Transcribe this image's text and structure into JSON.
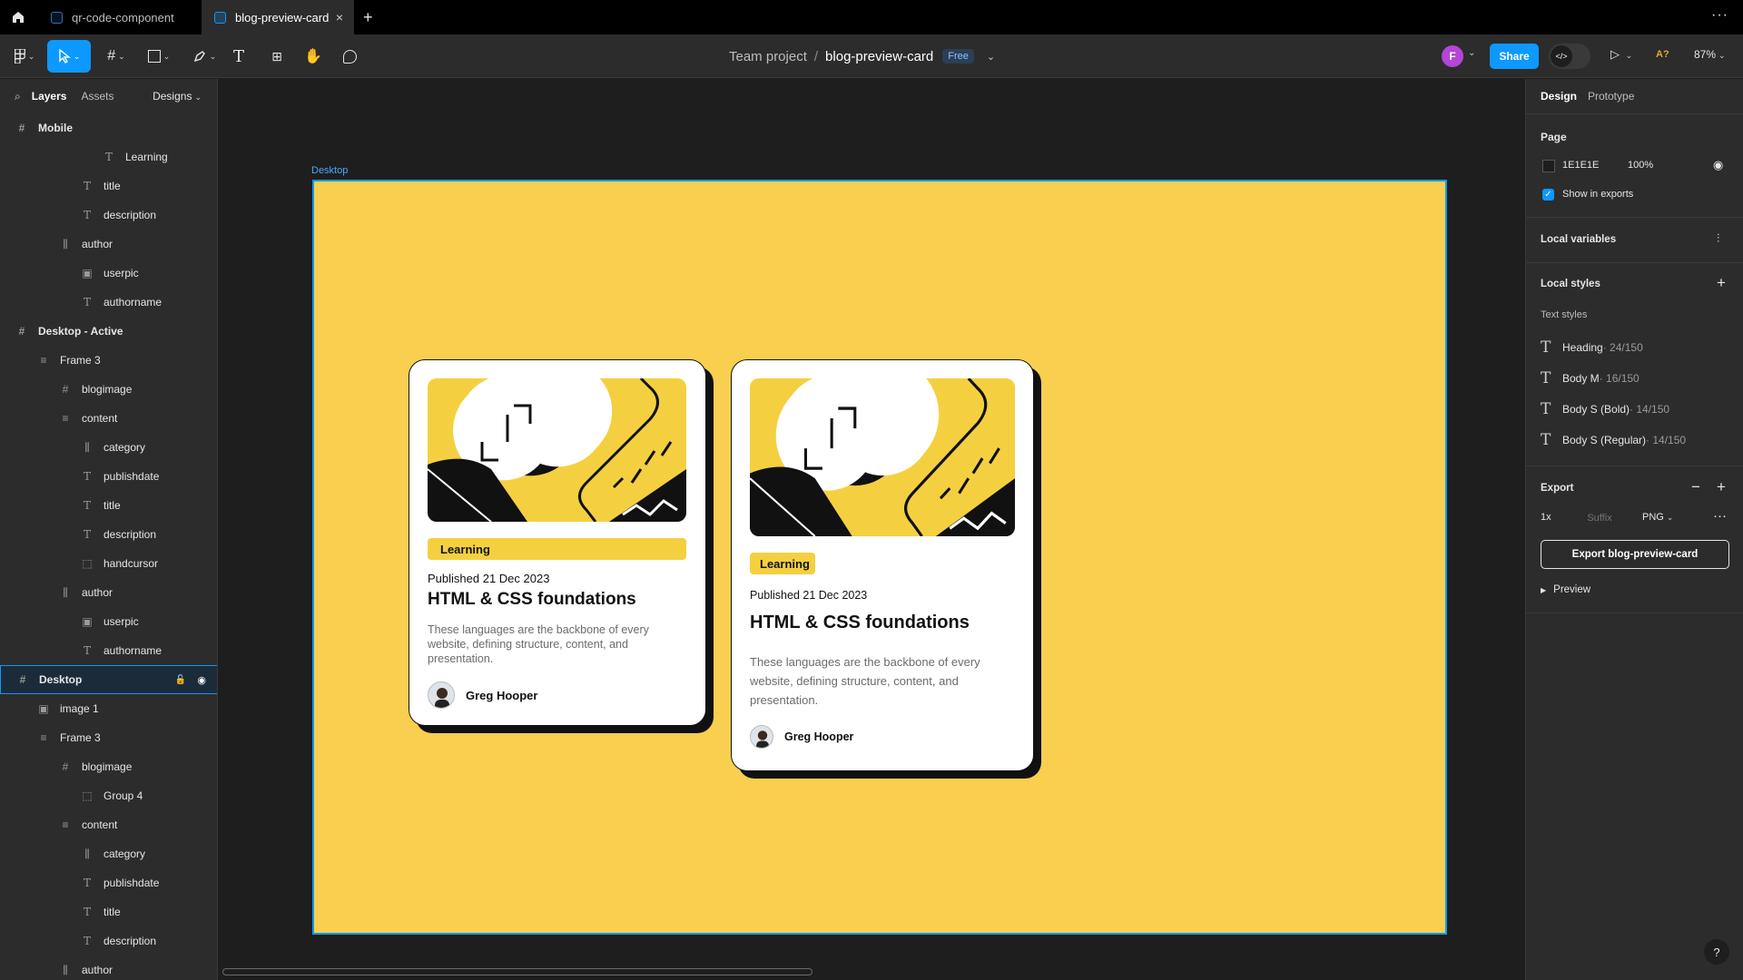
{
  "tabs": [
    {
      "label": "qr-code-component"
    },
    {
      "label": "blog-preview-card"
    }
  ],
  "toolbar": {
    "breadcrumb_project": "Team project",
    "breadcrumb_sep": "/",
    "file_name": "blog-preview-card",
    "plan_badge": "Free",
    "avatar_initial": "F",
    "share_label": "Share",
    "dev_mode_glyph": "</>",
    "a_label": "A?",
    "zoom": "87%"
  },
  "left_panel": {
    "tab_layers": "Layers",
    "tab_assets": "Assets",
    "designs_label": "Designs",
    "layers": [
      {
        "label": "Mobile",
        "icon": "frame-icon",
        "indent": 0,
        "bold": true
      },
      {
        "label": "Learning",
        "icon": "text-icon",
        "indent": 4
      },
      {
        "label": "title",
        "icon": "text-icon",
        "indent": 3
      },
      {
        "label": "description",
        "icon": "text-icon",
        "indent": 3
      },
      {
        "label": "author",
        "icon": "autolayout-h-icon",
        "indent": 2
      },
      {
        "label": "userpic",
        "icon": "image-icon",
        "indent": 3
      },
      {
        "label": "authorname",
        "icon": "text-icon",
        "indent": 3
      },
      {
        "label": "Desktop - Active",
        "icon": "frame-icon",
        "indent": 0,
        "bold": true
      },
      {
        "label": "Frame 3",
        "icon": "autolayout-v-icon",
        "indent": 1
      },
      {
        "label": "blogimage",
        "icon": "frame-icon",
        "indent": 2
      },
      {
        "label": "content",
        "icon": "autolayout-v-icon",
        "indent": 2
      },
      {
        "label": "category",
        "icon": "autolayout-h-icon",
        "indent": 3
      },
      {
        "label": "publishdate",
        "icon": "text-icon",
        "indent": 3
      },
      {
        "label": "title",
        "icon": "text-icon",
        "indent": 3
      },
      {
        "label": "description",
        "icon": "text-icon",
        "indent": 3
      },
      {
        "label": "handcursor",
        "icon": "group-icon",
        "indent": 3
      },
      {
        "label": "author",
        "icon": "autolayout-h-icon",
        "indent": 2
      },
      {
        "label": "userpic",
        "icon": "image-icon",
        "indent": 3
      },
      {
        "label": "authorname",
        "icon": "text-icon",
        "indent": 3
      },
      {
        "label": "Desktop",
        "icon": "frame-icon",
        "indent": 0,
        "bold": true,
        "selected": true
      },
      {
        "label": "image 1",
        "icon": "image-icon",
        "indent": 1
      },
      {
        "label": "Frame 3",
        "icon": "autolayout-v-icon",
        "indent": 1
      },
      {
        "label": "blogimage",
        "icon": "frame-icon",
        "indent": 2
      },
      {
        "label": "Group 4",
        "icon": "group-icon",
        "indent": 3
      },
      {
        "label": "content",
        "icon": "autolayout-v-icon",
        "indent": 2
      },
      {
        "label": "category",
        "icon": "autolayout-h-icon",
        "indent": 3
      },
      {
        "label": "publishdate",
        "icon": "text-icon",
        "indent": 3
      },
      {
        "label": "title",
        "icon": "text-icon",
        "indent": 3
      },
      {
        "label": "description",
        "icon": "text-icon",
        "indent": 3
      },
      {
        "label": "author",
        "icon": "autolayout-h-icon",
        "indent": 2
      }
    ]
  },
  "canvas": {
    "frame_label": "Desktop",
    "frame_color": "#f9cf4f",
    "cards": [
      {
        "category": "Learning",
        "published": "Published 21 Dec 2023",
        "title": "HTML & CSS foundations",
        "description": "These languages are the backbone of every website, defining structure, content, and presentation.",
        "author": "Greg Hooper"
      },
      {
        "category": "Learning",
        "published": "Published 21 Dec 2023",
        "title": "HTML & CSS foundations",
        "description": "These languages are the backbone of every website, defining structure, content, and presentation.",
        "author": "Greg Hooper"
      }
    ]
  },
  "right_panel": {
    "tab_design": "Design",
    "tab_prototype": "Prototype",
    "page_heading": "Page",
    "page_color": "1E1E1E",
    "page_opacity": "100%",
    "show_in_exports": "Show in exports",
    "local_variables": "Local variables",
    "local_styles": "Local styles",
    "text_styles_heading": "Text styles",
    "text_styles": [
      {
        "name": "Heading",
        "meta": " · 24/150"
      },
      {
        "name": "Body M",
        "meta": " · 16/150"
      },
      {
        "name": "Body S (Bold)",
        "meta": " · 14/150"
      },
      {
        "name": "Body S (Regular)",
        "meta": " · 14/150"
      }
    ],
    "export_heading": "Export",
    "export_scale": "1x",
    "export_suffix_placeholder": "Suffix",
    "export_format": "PNG",
    "export_button": "Export blog-preview-card",
    "preview_label": "Preview"
  },
  "help_label": "?"
}
